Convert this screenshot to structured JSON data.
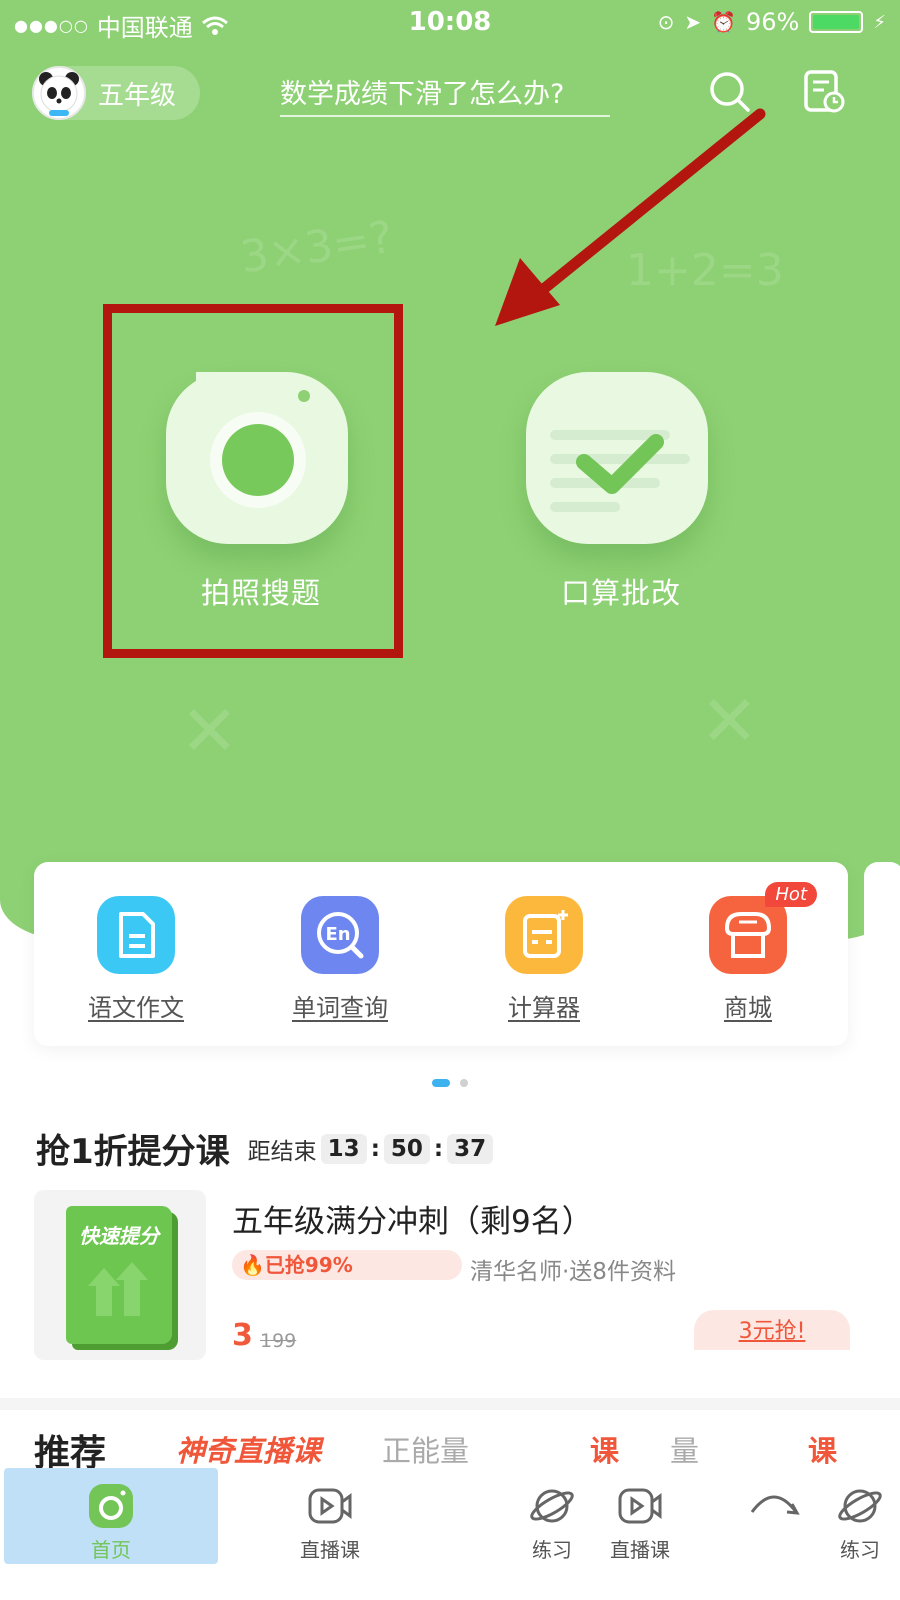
{
  "status_bar": {
    "carrier": "中国联通",
    "time": "10:08",
    "battery": "96%"
  },
  "header": {
    "grade": "五年级",
    "search_hint": "数学成绩下滑了怎么办?",
    "icons": [
      "search-icon",
      "history-icon"
    ]
  },
  "features": [
    {
      "label": "拍照搜题",
      "icon": "camera-icon"
    },
    {
      "label": "口算批改",
      "icon": "check-icon"
    }
  ],
  "tools": [
    {
      "label": "语文作文",
      "icon": "document-icon",
      "color": "#3cc8f5"
    },
    {
      "label": "单词查询",
      "icon": "word-search-icon",
      "color": "#6e86f0"
    },
    {
      "label": "计算器",
      "icon": "calculator-icon",
      "color": "#fbb83d"
    },
    {
      "label": "商城",
      "icon": "shop-icon",
      "color": "#f5643f",
      "badge": "Hot"
    }
  ],
  "flash_sale": {
    "title": "抢1折提分课",
    "ends_label": "距结束",
    "hours": "13",
    "minutes": "50",
    "seconds": "37",
    "course": {
      "cover_text": "快速提分",
      "title": "五年级满分冲刺（剩9名）",
      "grabbed": "已抢99%",
      "subtitle": "清华名师·送8件资料",
      "price": "3",
      "original_price": "199",
      "button": "3元抢!"
    }
  },
  "recommend": {
    "title": "推荐",
    "items": [
      "神奇直播课",
      "正能量",
      "课",
      "量",
      "课"
    ]
  },
  "tab_bar": [
    {
      "label": "首页",
      "icon": "home-camera-icon",
      "active": true
    },
    {
      "label": "直播课",
      "icon": "live-video-icon"
    },
    {
      "label": "练习",
      "icon": "planet-icon"
    },
    {
      "label": "直播课",
      "icon": "live-video-icon"
    },
    {
      "label": "练习",
      "icon": "planet-icon"
    }
  ],
  "colors": {
    "hero_green": "#8ed174",
    "annotation_red": "#b3150f",
    "accent_orange": "#f05a3a",
    "active_tab_bg": "#bfe0f6"
  }
}
